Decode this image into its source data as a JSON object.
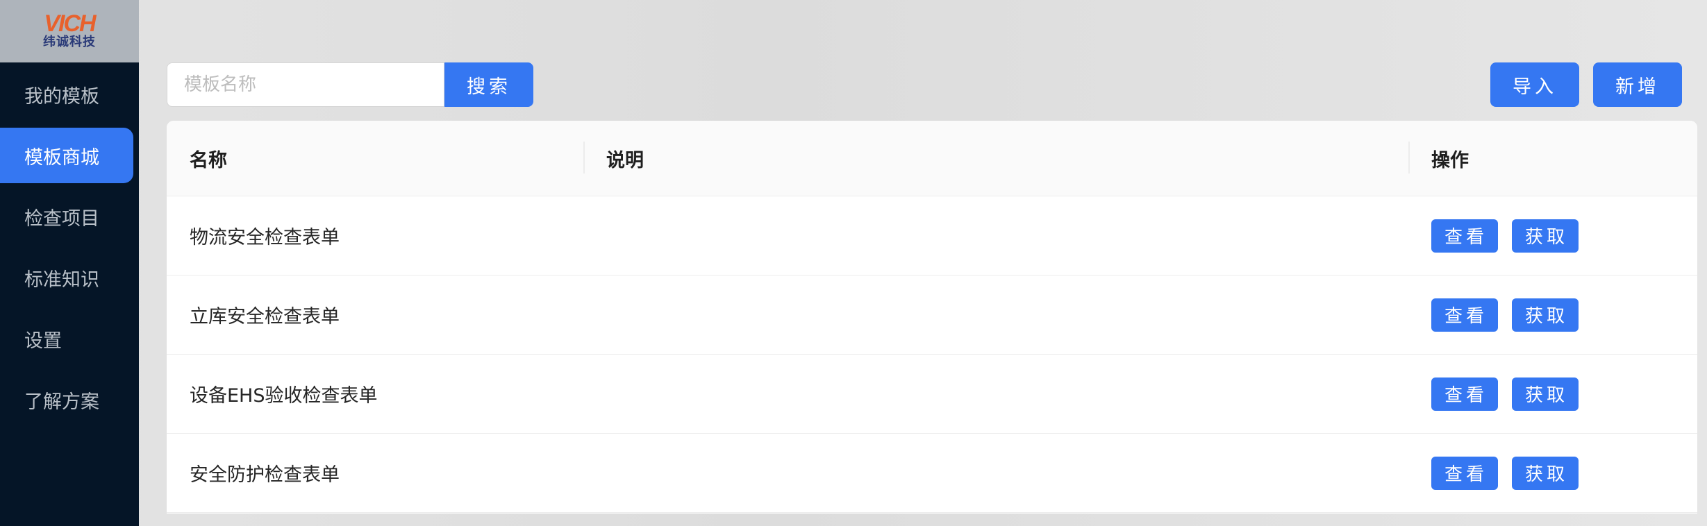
{
  "logo": {
    "mark": "VICH",
    "text": "纬诚科技"
  },
  "sidebar": {
    "items": [
      {
        "label": "我的模板",
        "active": false
      },
      {
        "label": "模板商城",
        "active": true
      },
      {
        "label": "检查项目",
        "active": false
      },
      {
        "label": "标准知识",
        "active": false
      },
      {
        "label": "设置",
        "active": false
      },
      {
        "label": "了解方案",
        "active": false
      }
    ]
  },
  "toolbar": {
    "search_placeholder": "模板名称",
    "search_value": "",
    "search_label": "搜索",
    "import_label": "导入",
    "add_label": "新增"
  },
  "table": {
    "headers": {
      "name": "名称",
      "desc": "说明",
      "op": "操作"
    },
    "rows": [
      {
        "name": "物流安全检查表单",
        "desc": ""
      },
      {
        "name": "立库安全检查表单",
        "desc": ""
      },
      {
        "name": "设备EHS验收检查表单",
        "desc": ""
      },
      {
        "name": "安全防护检查表单",
        "desc": ""
      }
    ],
    "actions": {
      "view": "查看",
      "get": "获取"
    }
  },
  "colors": {
    "accent": "#3577f2",
    "sidebar_bg": "#051527",
    "logo_bg": "#aeb4bb"
  }
}
